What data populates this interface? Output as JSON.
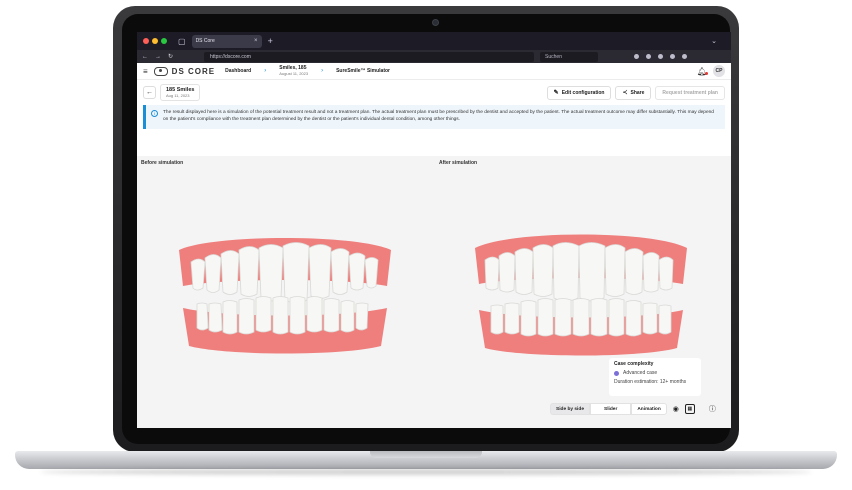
{
  "browser": {
    "tab_title": "DS Core",
    "url": "https://dscore.com",
    "search_placeholder": "Suchen"
  },
  "app": {
    "logo": "DS CORE",
    "breadcrumbs": [
      {
        "label": "Dashboard"
      },
      {
        "label": "Smiles, 185",
        "sub": "August 11, 2023"
      },
      {
        "label": "SureSmile™ Simulator"
      }
    ],
    "user_initials": "CP"
  },
  "case": {
    "title": "185 Smiles",
    "date": "Aug 11, 2023"
  },
  "actions": {
    "edit": "Edit configuration",
    "share": "Share",
    "request": "Request treatment plan"
  },
  "banner": {
    "text": "The result displayed here is a simulation of the potential treatment result and not a treatment plan. The actual treatment plan must be prescribed by the dentist and accepted by the patient. The actual treatment outcome may differ substantially. This may depend on the patient's compliance with the treatment plan determined by the dentist or the patient's individual dental condition, among other things."
  },
  "viewer": {
    "before_label": "Before simulation",
    "after_label": "After simulation"
  },
  "complexity": {
    "title": "Case complexity",
    "level": "Advanced case",
    "duration": "Duration estimation:  12+ months",
    "level_color": "#7b6fd8"
  },
  "view_modes": {
    "side": "Side by side",
    "slider": "Slider",
    "animation": "Animation"
  },
  "colors": {
    "accent": "#1a8fd6",
    "gum": "#ef7f7d",
    "tooth": "#f7f7f5"
  }
}
